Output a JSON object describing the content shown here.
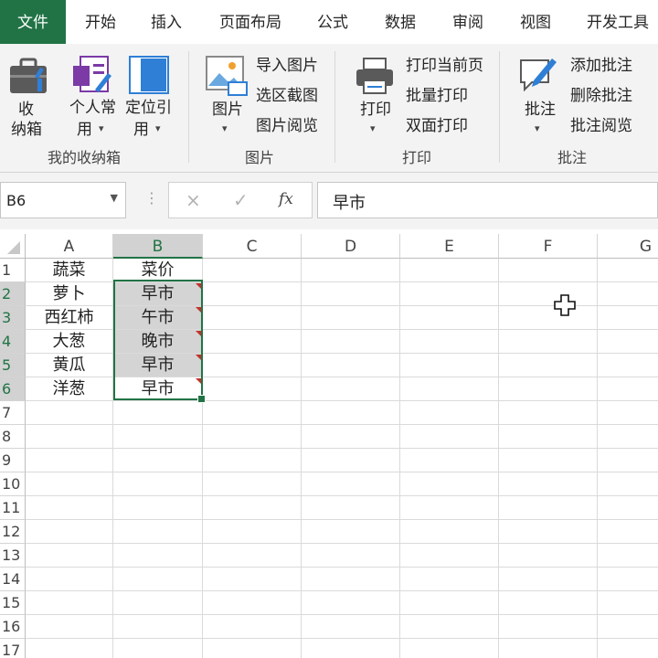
{
  "tabs": [
    {
      "label": "文件",
      "active": true
    },
    {
      "label": "开始"
    },
    {
      "label": "插入"
    },
    {
      "label": "页面布局"
    },
    {
      "label": "公式"
    },
    {
      "label": "数据"
    },
    {
      "label": "审阅"
    },
    {
      "label": "视图"
    },
    {
      "label": "开发工具"
    }
  ],
  "ribbon": {
    "groups": [
      {
        "name": "我的收纳箱",
        "items": [
          {
            "line1": "收",
            "line2": "纳箱",
            "icon": "toolbox-icon"
          },
          {
            "line1": "个人常",
            "line2": "用",
            "icon": "personal-form-icon",
            "dropdown": true
          },
          {
            "line1": "定位引",
            "line2": "用",
            "icon": "locate-reference-icon",
            "dropdown": true
          }
        ]
      },
      {
        "name": "图片",
        "items": [
          {
            "line1": "图片",
            "icon": "picture-icon",
            "dropdown": true
          },
          {
            "label": "导入图片"
          },
          {
            "label": "选区截图"
          },
          {
            "label": "图片阅览"
          }
        ]
      },
      {
        "name": "打印",
        "items": [
          {
            "line1": "打印",
            "icon": "printer-icon",
            "dropdown": true
          },
          {
            "label": "打印当前页"
          },
          {
            "label": "批量打印"
          },
          {
            "label": "双面打印"
          }
        ]
      },
      {
        "name": "批注",
        "items": [
          {
            "line1": "批注",
            "icon": "comment-pen-icon",
            "dropdown": true
          },
          {
            "label": "添加批注"
          },
          {
            "label": "删除批注"
          },
          {
            "label": "批注阅览"
          }
        ]
      }
    ]
  },
  "formula_bar": {
    "name_box": "B6",
    "cancel": "×",
    "enter": "✓",
    "fx": "fx",
    "formula": "早市"
  },
  "sheet": {
    "columns": [
      "A",
      "B",
      "C",
      "D",
      "E",
      "F",
      "G"
    ],
    "rows": [
      "1",
      "2",
      "3",
      "4",
      "5",
      "6",
      "7",
      "8",
      "9",
      "10",
      "11",
      "12",
      "13",
      "14",
      "15",
      "16",
      "17"
    ],
    "data": [
      [
        "蔬菜",
        "菜价"
      ],
      [
        "萝卜",
        "早市"
      ],
      [
        "西红柿",
        "午市"
      ],
      [
        "大葱",
        "晚市"
      ],
      [
        "黄瓜",
        "早市"
      ],
      [
        "洋葱",
        "早市"
      ]
    ],
    "selected_range": "B2:B6",
    "active_cell": "B6",
    "comment_cells": [
      "B2",
      "B3",
      "B4",
      "B5",
      "B6"
    ]
  },
  "colors": {
    "accent": "#217346",
    "selection_fill": "#d4d4d4",
    "comment_marker": "#c4302b"
  }
}
